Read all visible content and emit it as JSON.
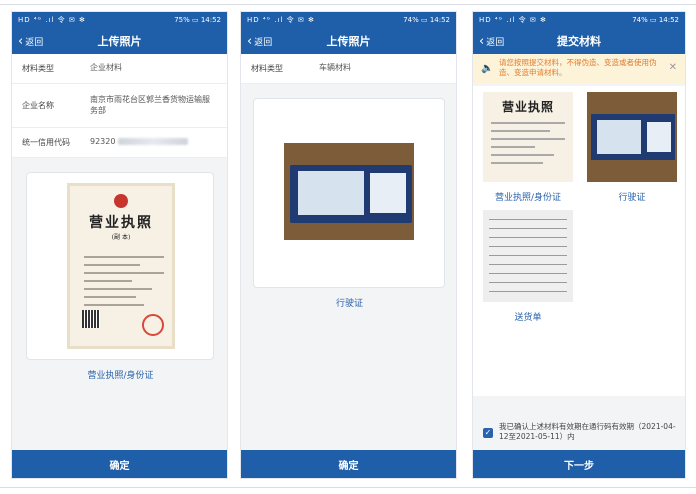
{
  "status_bars": [
    {
      "left": "HD ⁴ᴳ .ıl 令 ✉ ✻",
      "right": "75% ▭ 14:52"
    },
    {
      "left": "HD ⁴ᴳ .ıl 令 ✉ ✻",
      "right": "74% ▭ 14:52"
    },
    {
      "left": "HD ⁴ᴳ .ıl 令 ✉ ✻",
      "right": "74% ▭ 14:52"
    }
  ],
  "screen1": {
    "back": "返回",
    "title": "上传照片",
    "rows": [
      {
        "label": "材料类型",
        "value": "企业材料"
      },
      {
        "label": "企业名称",
        "value": "南京市雨花台区郭兰香货物运输服务部"
      },
      {
        "label": "统一信用代码",
        "value": "92320"
      }
    ],
    "license": {
      "title": "营业执照",
      "subtitle": "(副 本)"
    },
    "caption": "营业执照/身份证",
    "button": "确定"
  },
  "screen2": {
    "back": "返回",
    "title": "上传照片",
    "rows": [
      {
        "label": "材料类型",
        "value": "车辆材料"
      }
    ],
    "caption": "行驶证",
    "button": "确定"
  },
  "screen3": {
    "back": "返回",
    "title": "提交材料",
    "tip": "请您按照提交材料，不得伪造、变造或者使用伪造、变造申请材料。",
    "items": [
      {
        "label": "营业执照/身份证"
      },
      {
        "label": "行驶证"
      },
      {
        "label": "送货单"
      }
    ],
    "license_title": "营业执照",
    "confirm": "我已确认上述材料有效期在通行码有效期（2021-04-12至2021-05-11）内",
    "button": "下一步"
  }
}
